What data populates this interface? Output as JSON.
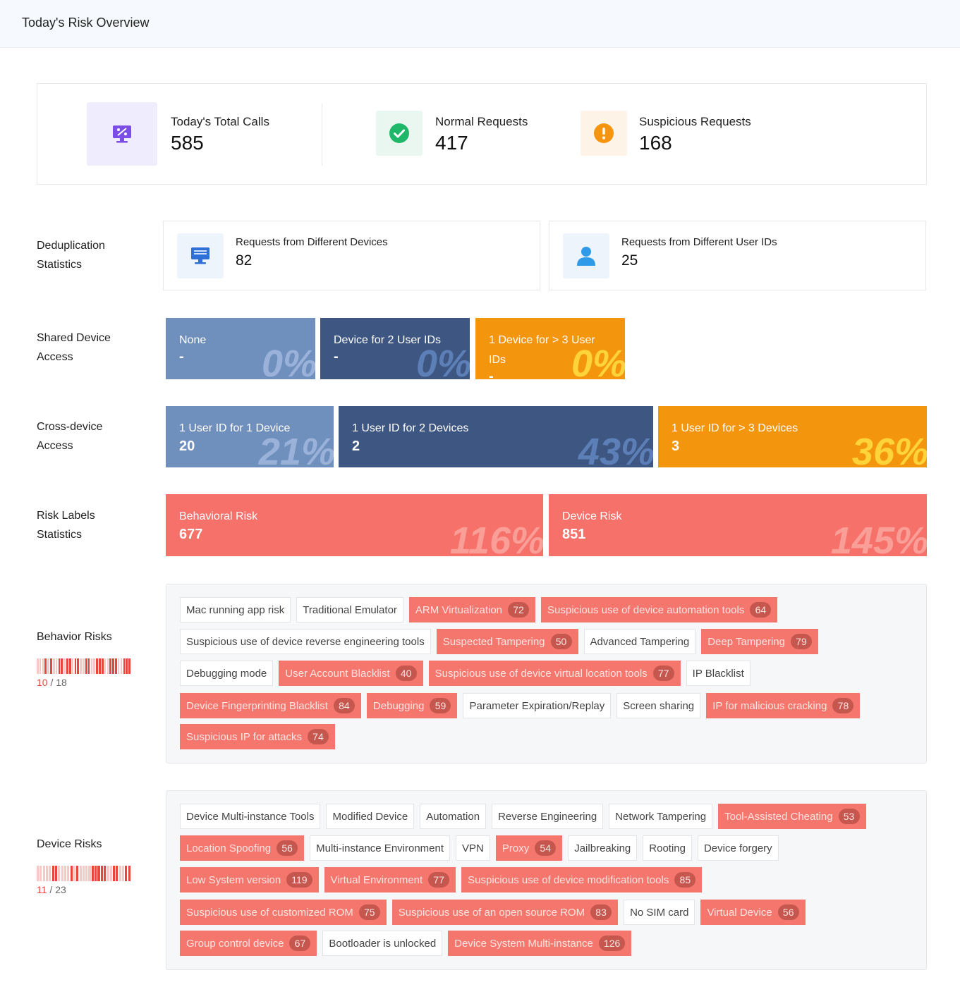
{
  "header": {
    "title": "Today's Risk Overview"
  },
  "summary": {
    "total": {
      "label": "Today's Total Calls",
      "value": "585",
      "icon": "monitor-chart-icon"
    },
    "normal": {
      "label": "Normal Requests",
      "value": "417",
      "icon": "check-circle-icon"
    },
    "suspicious": {
      "label": "Suspicious Requests",
      "value": "168",
      "icon": "alert-circle-icon"
    }
  },
  "dedup": {
    "title": "Deduplication Statistics",
    "devices": {
      "label": "Requests from Different Devices",
      "value": "82",
      "icon": "monitor-icon"
    },
    "users": {
      "label": "Requests from Different User IDs",
      "value": "25",
      "icon": "user-icon"
    }
  },
  "shared": {
    "title": "Shared Device Access",
    "tiles": [
      {
        "label": "None",
        "value": "-",
        "pct": "0%"
      },
      {
        "label": "Device for 2 User IDs",
        "value": "-",
        "pct": "0%"
      },
      {
        "label": "1 Device for > 3 User IDs",
        "value": "-",
        "pct": "0%"
      }
    ]
  },
  "cross": {
    "title": "Cross-device Access",
    "tiles": [
      {
        "label": "1 User ID for 1 Device",
        "value": "20",
        "pct": "21%"
      },
      {
        "label": "1 User ID for 2 Devices",
        "value": "2",
        "pct": "43%"
      },
      {
        "label": "1 User ID for > 3 Devices",
        "value": "3",
        "pct": "36%"
      }
    ]
  },
  "risk_labels": {
    "title": "Risk Labels Statistics",
    "tiles": [
      {
        "label": "Behavioral Risk",
        "value": "677",
        "pct": "116%"
      },
      {
        "label": "Device Risk",
        "value": "851",
        "pct": "145%"
      }
    ]
  },
  "colors": {
    "hit": "#f5766d",
    "navy": "#3e5782",
    "lightblue": "#6f8fbd",
    "orange": "#f4950e",
    "red": "#f6716a"
  },
  "behavior": {
    "title": "Behavior Risks",
    "hit_count": "10",
    "total_count": "18",
    "pattern": [
      0,
      0,
      0,
      1,
      0,
      1,
      0,
      0,
      1,
      1,
      0,
      1,
      1,
      0,
      1,
      1,
      0,
      0,
      1,
      1,
      0,
      0,
      1,
      1,
      1,
      0,
      0,
      1,
      1,
      1,
      0,
      0,
      1,
      1,
      1
    ],
    "rows": [
      [
        {
          "label": "Mac running app risk"
        },
        {
          "label": "Traditional Emulator"
        },
        {
          "label": "ARM Virtualization",
          "count": "72"
        },
        {
          "label": "Suspicious use of device automation tools",
          "count": "64"
        }
      ],
      [
        {
          "label": "Suspicious use of device reverse engineering tools"
        },
        {
          "label": "Suspected Tampering",
          "count": "50"
        },
        {
          "label": "Advanced Tampering"
        },
        {
          "label": "Deep Tampering",
          "count": "79"
        }
      ],
      [
        {
          "label": "Debugging mode"
        },
        {
          "label": "User Account Blacklist",
          "count": "40"
        },
        {
          "label": "Suspicious use of device virtual location tools",
          "count": "77"
        },
        {
          "label": "IP Blacklist"
        }
      ],
      [
        {
          "label": "Device Fingerprinting Blacklist",
          "count": "84"
        },
        {
          "label": "Debugging",
          "count": "59"
        },
        {
          "label": "Parameter Expiration/Replay"
        },
        {
          "label": "Screen sharing"
        },
        {
          "label": "IP for malicious cracking",
          "count": "78"
        }
      ],
      [
        {
          "label": "Suspicious IP for attacks",
          "count": "74"
        }
      ]
    ]
  },
  "device": {
    "title": "Device Risks",
    "hit_count": "11",
    "total_count": "23",
    "pattern": [
      0,
      0,
      0,
      0,
      0,
      1,
      1,
      0,
      0,
      0,
      0,
      1,
      0,
      1,
      0,
      0,
      0,
      0,
      1,
      1,
      1,
      1,
      1,
      0,
      0,
      1,
      1,
      0,
      0,
      1,
      1
    ],
    "rows": [
      [
        {
          "label": "Device Multi-instance Tools"
        },
        {
          "label": "Modified Device"
        },
        {
          "label": "Automation"
        },
        {
          "label": "Reverse Engineering"
        },
        {
          "label": "Network Tampering"
        },
        {
          "label": "Tool-Assisted Cheating",
          "count": "53"
        }
      ],
      [
        {
          "label": "Location Spoofing",
          "count": "56"
        },
        {
          "label": "Multi-instance Environment"
        },
        {
          "label": "VPN"
        },
        {
          "label": "Proxy",
          "count": "54"
        },
        {
          "label": "Jailbreaking"
        },
        {
          "label": "Rooting"
        },
        {
          "label": "Device forgery"
        }
      ],
      [
        {
          "label": "Low System version",
          "count": "119"
        },
        {
          "label": "Virtual Environment",
          "count": "77"
        },
        {
          "label": "Suspicious use of device modification tools",
          "count": "85"
        }
      ],
      [
        {
          "label": "Suspicious use of customized ROM",
          "count": "75"
        },
        {
          "label": "Suspicious use of an open source ROM",
          "count": "83"
        },
        {
          "label": "No SIM card"
        },
        {
          "label": "Virtual Device",
          "count": "56"
        }
      ],
      [
        {
          "label": "Group control device",
          "count": "67"
        },
        {
          "label": "Bootloader is unlocked"
        },
        {
          "label": "Device System Multi-instance",
          "count": "126"
        }
      ]
    ]
  }
}
